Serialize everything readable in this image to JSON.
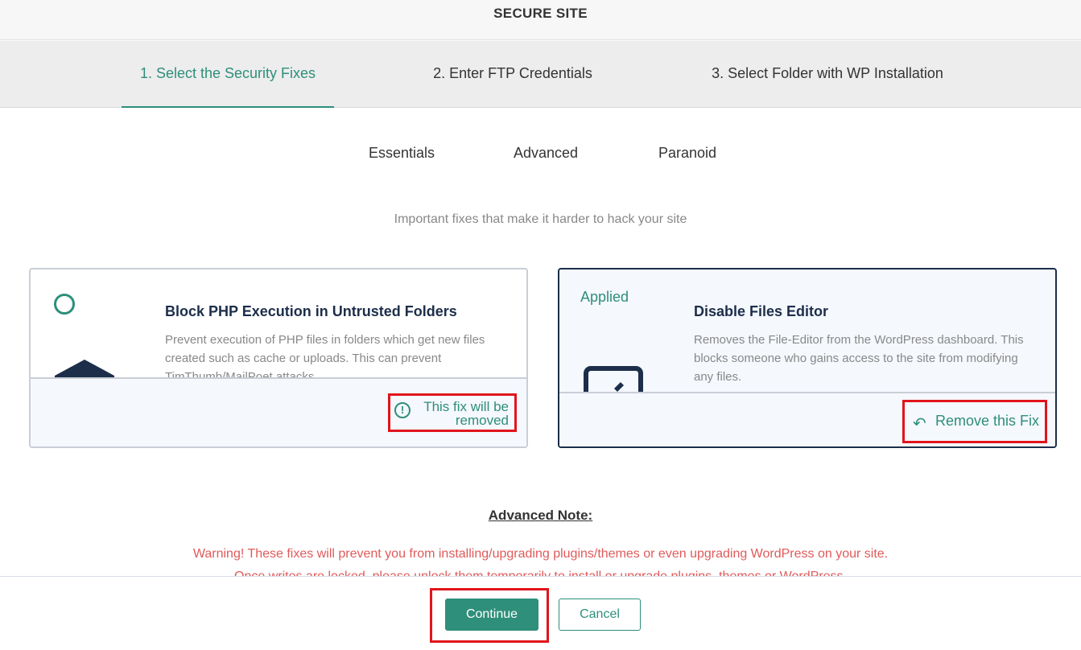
{
  "header": {
    "title": "SECURE SITE"
  },
  "steps": [
    {
      "label": "1. Select the Security Fixes"
    },
    {
      "label": "2. Enter FTP Credentials"
    },
    {
      "label": "3. Select Folder with WP Installation"
    }
  ],
  "subtabs": [
    {
      "label": "Essentials"
    },
    {
      "label": "Advanced"
    },
    {
      "label": "Paranoid"
    }
  ],
  "subtitle": "Important fixes that make it harder to hack your site",
  "cards": [
    {
      "title": "Block PHP Execution in Untrusted Folders",
      "description": "Prevent execution of PHP files in folders which get new files created such as cache or uploads. This can prevent TimThumb/MailPoet attacks.",
      "footer_note": "This fix will be removed",
      "icon": "shield-icon"
    },
    {
      "status": "Applied",
      "title": "Disable Files Editor",
      "description": "Removes the File-Editor from the WordPress dashboard. This blocks someone who gains access to the site from modifying any files.",
      "action_label": "Remove this Fix",
      "icon": "file-editor-icon"
    }
  ],
  "advanced_note": {
    "heading": "Advanced Note:",
    "warning": "Warning! These fixes will prevent you from installing/upgrading plugins/themes or even upgrading WordPress on your site.",
    "warning_2": "Once writes are locked, please unlock them temporarily to install or upgrade plugins, themes or WordPress."
  },
  "footer": {
    "continue_label": "Continue",
    "cancel_label": "Cancel"
  },
  "colors": {
    "accent": "#2e8f7a",
    "navy": "#1c2e4a",
    "highlight": "#e0151b",
    "warning": "#e05a5a"
  }
}
